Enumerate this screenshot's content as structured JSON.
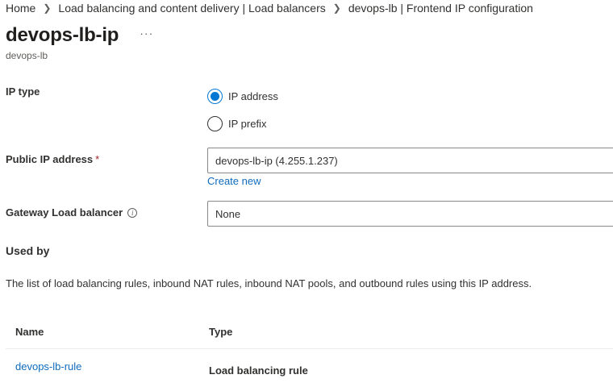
{
  "breadcrumb": {
    "items": [
      "Home",
      "Load balancing and content delivery | Load balancers",
      "devops-lb | Frontend IP configuration"
    ]
  },
  "header": {
    "title": "devops-lb-ip",
    "more": "···",
    "subtitle": "devops-lb"
  },
  "form": {
    "ip_type": {
      "label": "IP type",
      "options": [
        "IP address",
        "IP prefix"
      ],
      "selected": "IP address"
    },
    "public_ip": {
      "label": "Public IP address",
      "required_mark": "*",
      "value": "devops-lb-ip (4.255.1.237)",
      "create_new": "Create new"
    },
    "gateway_lb": {
      "label": "Gateway Load balancer",
      "info": "i",
      "value": "None"
    }
  },
  "used_by": {
    "title": "Used by",
    "description": "The list of load balancing rules, inbound NAT rules, inbound NAT pools, and outbound rules using this IP address.",
    "columns": [
      "Name",
      "Type"
    ],
    "rows": [
      {
        "name": "devops-lb-rule",
        "type": "Load balancing rule"
      }
    ]
  }
}
